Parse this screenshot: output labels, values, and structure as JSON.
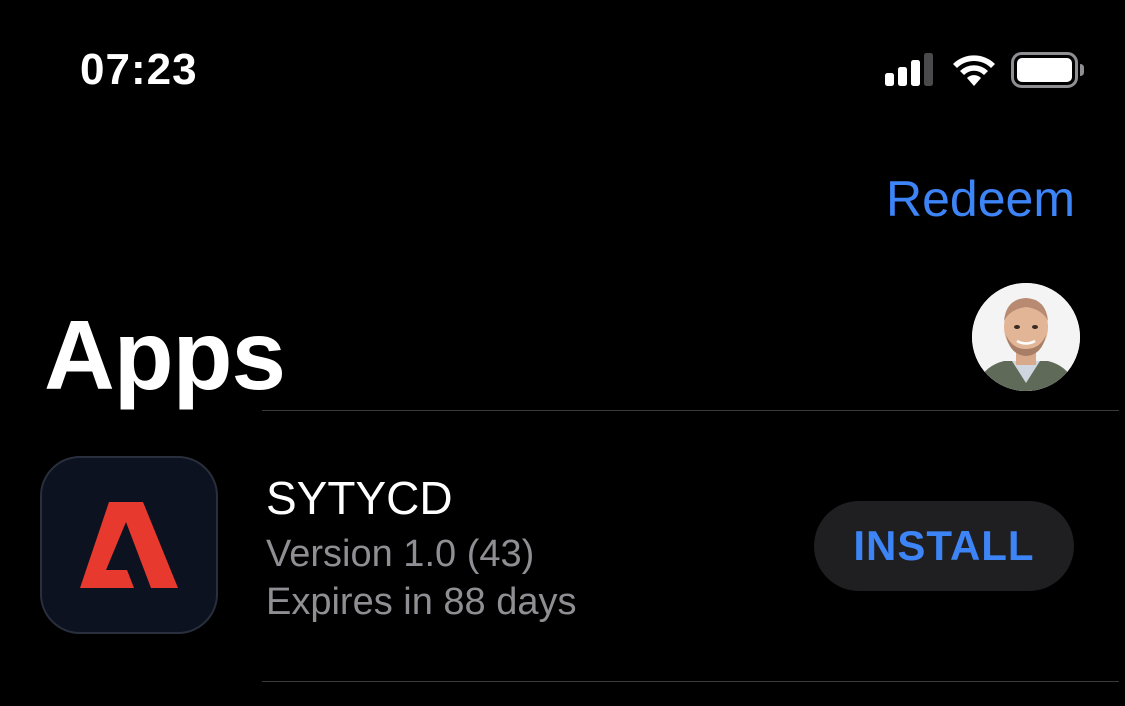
{
  "status_bar": {
    "time": "07:23",
    "icons": [
      "cellular-signal-icon",
      "wifi-icon",
      "battery-icon"
    ]
  },
  "nav": {
    "redeem_label": "Redeem"
  },
  "header": {
    "title": "Apps"
  },
  "apps": [
    {
      "name": "SYTYCD",
      "version": "Version 1.0 (43)",
      "expires": "Expires in 88 days",
      "action_label": "INSTALL",
      "icon": "adobe-logo-icon"
    }
  ],
  "colors": {
    "background": "#000000",
    "accent": "#3d84f7",
    "secondary_text": "#8e8e93",
    "button_background": "#1f1f21",
    "app_icon_red": "#e8392e"
  }
}
